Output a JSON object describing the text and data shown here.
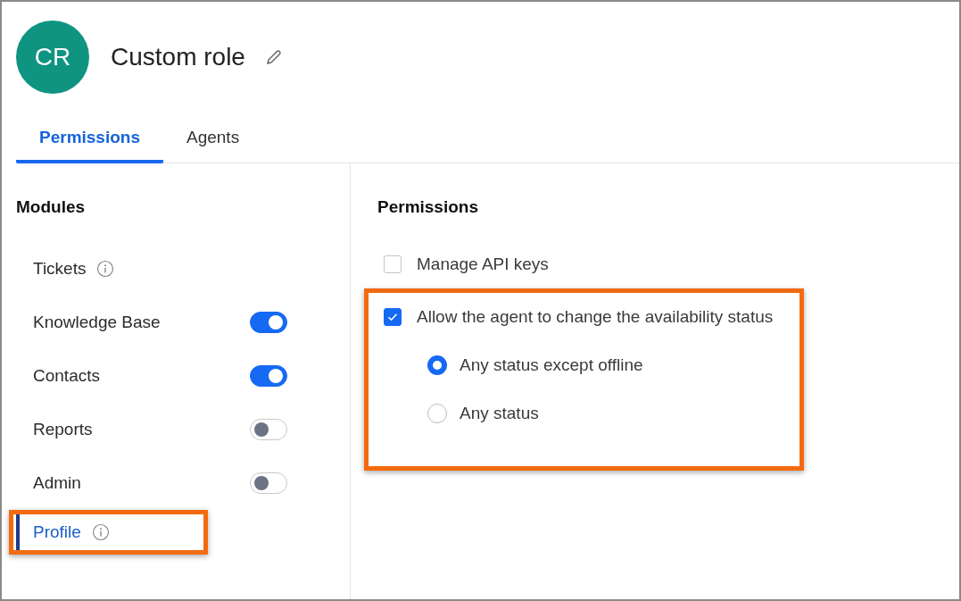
{
  "header": {
    "avatar_initials": "CR",
    "title": "Custom role"
  },
  "tabs": [
    {
      "label": "Permissions",
      "selected": true
    },
    {
      "label": "Agents",
      "selected": false
    }
  ],
  "modules": {
    "heading": "Modules",
    "items": [
      {
        "label": "Tickets",
        "kind": "info",
        "selected": false,
        "highlighted": false
      },
      {
        "label": "Knowledge Base",
        "kind": "toggle",
        "on": true,
        "selected": false,
        "highlighted": false
      },
      {
        "label": "Contacts",
        "kind": "toggle",
        "on": true,
        "selected": false,
        "highlighted": false
      },
      {
        "label": "Reports",
        "kind": "toggle",
        "on": false,
        "selected": false,
        "highlighted": false
      },
      {
        "label": "Admin",
        "kind": "toggle",
        "on": false,
        "selected": false,
        "highlighted": false
      },
      {
        "label": "Profile",
        "kind": "info",
        "selected": true,
        "highlighted": true
      }
    ]
  },
  "permissions": {
    "heading": "Permissions",
    "items": [
      {
        "label": "Manage API keys",
        "checked": false,
        "highlighted": false
      },
      {
        "label": "Allow the agent to change the availability status",
        "checked": true,
        "highlighted": true,
        "options": [
          {
            "label": "Any status except offline",
            "selected": true
          },
          {
            "label": "Any status",
            "selected": false
          }
        ]
      }
    ]
  }
}
